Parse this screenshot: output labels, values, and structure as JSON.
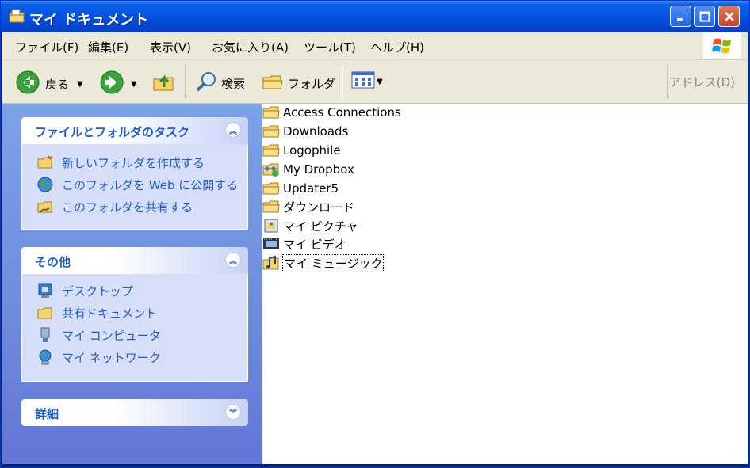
{
  "window": {
    "title": "マイ ドキュメント"
  },
  "menu": [
    "ファイル(F)",
    "編集(E)",
    "表示(V)",
    "お気に入り(A)",
    "ツール(T)",
    "ヘルプ(H)"
  ],
  "toolbar": {
    "back": "戻る",
    "search": "検索",
    "folders": "フォルダ",
    "address": "アドレス(D)"
  },
  "tasks_panel": {
    "title": "ファイルとフォルダのタスク",
    "items": [
      "新しいフォルダを作成する",
      "このフォルダを Web に公開する",
      "このフォルダを共有する"
    ]
  },
  "other_panel": {
    "title": "その他",
    "items": [
      "デスクトップ",
      "共有ドキュメント",
      "マイ コンピュータ",
      "マイ ネットワーク"
    ]
  },
  "details_panel": {
    "title": "詳細"
  },
  "files": [
    "Access Connections",
    "Downloads",
    "Logophile",
    "My Dropbox",
    "Updater5",
    "ダウンロード",
    "マイ ピクチャ",
    "マイ ビデオ",
    "マイ ミュージック"
  ],
  "colors": {
    "titlebar": "#0554e3",
    "sidebar": "#6f8ddd",
    "link": "#215dc6",
    "chrome": "#ece9d8"
  }
}
